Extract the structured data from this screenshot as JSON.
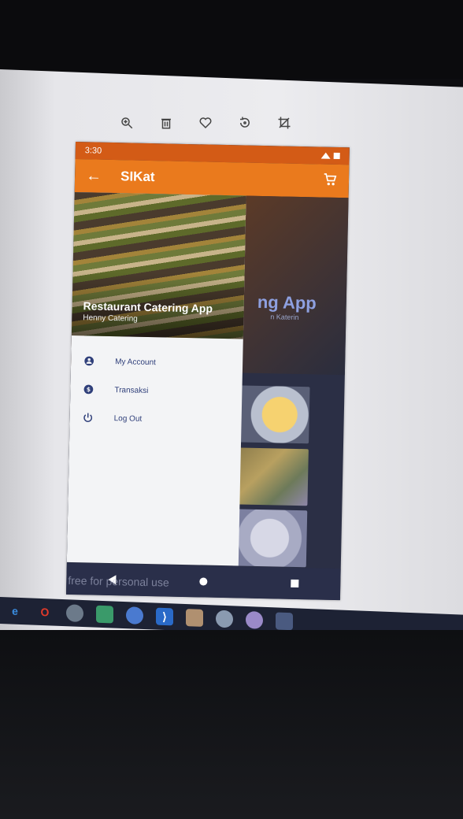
{
  "phone": {
    "status_time": "3:30",
    "app_title": "SIKat",
    "drawer_title": "Restaurant Catering App",
    "drawer_subtitle": "Henny Catering",
    "menu": [
      {
        "label": "My Account",
        "icon": "account-circle-icon"
      },
      {
        "label": "Transaksi",
        "icon": "dollar-circle-icon"
      },
      {
        "label": "Log Out",
        "icon": "power-icon"
      }
    ],
    "background_title": "ng App",
    "background_subtitle": "n Katerin",
    "watermark": "free for personal use"
  },
  "viewer_toolbar": [
    "zoom-icon",
    "delete-icon",
    "heart-icon",
    "rotate-icon",
    "crop-icon"
  ],
  "colors": {
    "status_bar": "#d35b16",
    "app_bar": "#ea7a1d",
    "menu_text": "#2f3f7a"
  }
}
